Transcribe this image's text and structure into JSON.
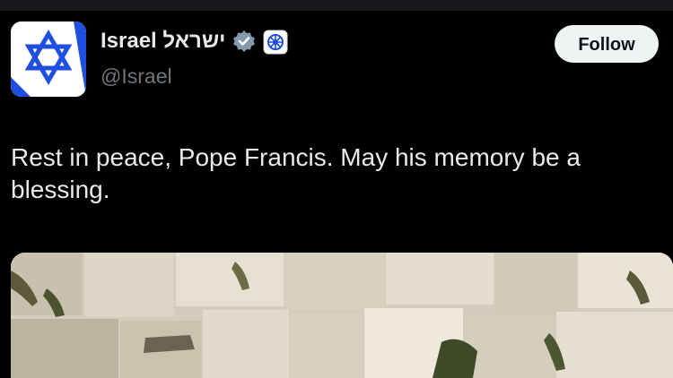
{
  "author": {
    "display_name": "Israel ישראל",
    "handle": "@Israel",
    "verified_icon": "verified-badge-icon",
    "affiliate_icon": "government-affiliate-icon",
    "avatar_icon": "star-of-david-flag-icon"
  },
  "actions": {
    "follow_label": "Follow"
  },
  "tweet": {
    "text": "Rest in peace, Pope Francis. May his memory be a blessing.",
    "media_description": ""
  },
  "colors": {
    "background": "#000000",
    "text": "#e7e9ea",
    "secondary_text": "#71767b",
    "flag_blue": "#1f4fe0",
    "follow_bg": "#eff3f4"
  }
}
